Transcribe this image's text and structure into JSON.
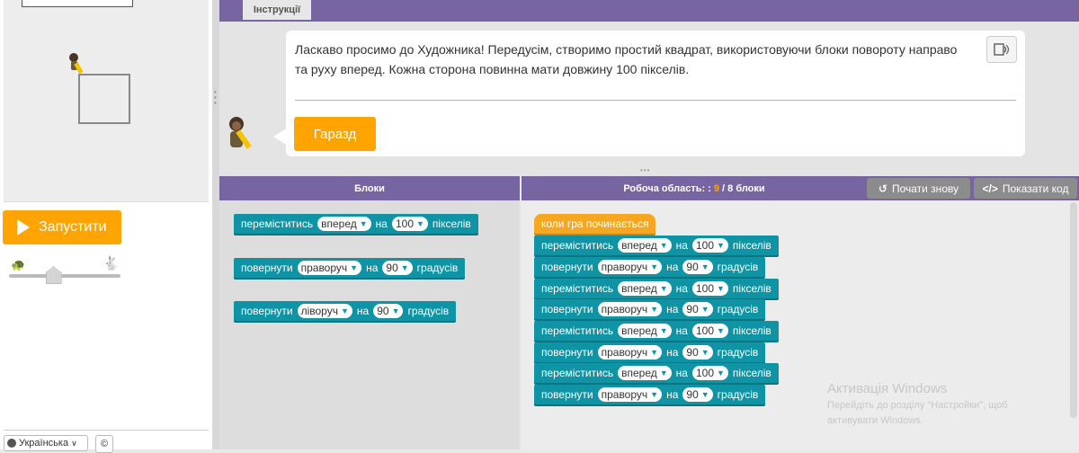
{
  "instructions": {
    "tab_label": "Інструкції",
    "text": "Ласкаво просимо до Художника! Передусім, створимо простий квадрат, використовуючи блоки повороту направо та руху вперед. Кожна сторона повинна мати довжину 100 пікселів.",
    "ok_label": "Гаразд"
  },
  "controls": {
    "run_label": "Запустити",
    "speed_slider_level": 0.4,
    "language": "Українська",
    "copyright": "©"
  },
  "workspace_header": {
    "toolbox_title": "Блоки",
    "workspace_title_prefix": "Робоча область: :",
    "block_count": "9",
    "block_limit": "/ 8 блоки",
    "restart_label": "Почати знову",
    "show_code_label": "Показати код"
  },
  "toolbox": {
    "move_block": {
      "verb": "переміститись",
      "dir": "вперед",
      "on": "на",
      "value": "100",
      "unit": "пікселів"
    },
    "turn_right_block": {
      "verb": "повернути",
      "dir": "праворуч",
      "on": "на",
      "value": "90",
      "unit": "градусів"
    },
    "turn_left_block": {
      "verb": "повернути",
      "dir": "ліворуч",
      "on": "на",
      "value": "90",
      "unit": "градусів"
    }
  },
  "program": {
    "hat": "коли гра починається",
    "blocks": [
      {
        "verb": "переміститись",
        "dir": "вперед",
        "on": "на",
        "value": "100",
        "unit": "пікселів"
      },
      {
        "verb": "повернути",
        "dir": "праворуч",
        "on": "на",
        "value": "90",
        "unit": "градусів"
      },
      {
        "verb": "переміститись",
        "dir": "вперед",
        "on": "на",
        "value": "100",
        "unit": "пікселів"
      },
      {
        "verb": "повернути",
        "dir": "праворуч",
        "on": "на",
        "value": "90",
        "unit": "градусів"
      },
      {
        "verb": "переміститись",
        "dir": "вперед",
        "on": "на",
        "value": "100",
        "unit": "пікселів"
      },
      {
        "verb": "повернути",
        "dir": "праворуч",
        "on": "на",
        "value": "90",
        "unit": "градусів"
      },
      {
        "verb": "переміститись",
        "dir": "вперед",
        "on": "на",
        "value": "100",
        "unit": "пікселів"
      },
      {
        "verb": "повернути",
        "dir": "праворуч",
        "on": "на",
        "value": "90",
        "unit": "градусів"
      }
    ]
  },
  "watermark": {
    "line1": "Активація Windows",
    "line2": "Перейдіть до розділу \"Настройки\", щоб",
    "line3": "активувати Windows."
  },
  "icons": {
    "run": "play-icon",
    "speaker": "speaker-icon",
    "restart": "restart-icon",
    "code": "code-icon",
    "turtle": "turtle-icon",
    "rabbit": "rabbit-icon",
    "globe": "globe-icon"
  },
  "colors": {
    "header_purple": "#7665a0",
    "accent_orange": "#ffa400",
    "block_teal": "#0e94a5",
    "hat_orange": "#f7a620"
  }
}
